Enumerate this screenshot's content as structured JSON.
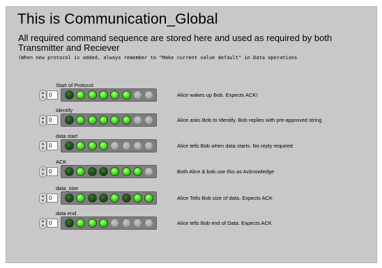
{
  "header": {
    "title": "This is Communication_Global",
    "description": "All required command sequence are stored here and used as required by both Transmitter and Reciever",
    "note": "(When new protocol is added, always remember to \"Make current value default\" in Data operations"
  },
  "colors": {
    "panel_bg": "#c8c8c8",
    "led_on": "#3fe814",
    "led_off": "#124a10",
    "led_na": "#a7a7a7"
  },
  "rows": [
    {
      "label": "Start of Protocol",
      "value": "0",
      "leds": [
        "off",
        "on",
        "on",
        "on",
        "on",
        "on",
        "na",
        "na"
      ],
      "description": "Alice wakes up Bob. Expects ACK!"
    },
    {
      "label": "Identify",
      "value": "0",
      "leds": [
        "off",
        "on",
        "on",
        "on",
        "on",
        "on",
        "na",
        "na"
      ],
      "description": "Alice asks Bob to Identify. Bob replies with pre-approved string"
    },
    {
      "label": "data start",
      "value": "0",
      "leds": [
        "off",
        "on",
        "on",
        "on",
        "na",
        "na",
        "na",
        "na"
      ],
      "description": "Alice tells Bob when data starts. No reply required"
    },
    {
      "label": "ACK",
      "value": "0",
      "leds": [
        "off",
        "on",
        "off",
        "off",
        "on",
        "on",
        "on",
        "na"
      ],
      "description": "Both Alice & bob use this as Acknowledge"
    },
    {
      "label": "data_size",
      "value": "0",
      "leds": [
        "off",
        "on",
        "off",
        "off",
        "on",
        "off",
        "on",
        "on"
      ],
      "description": "Alice Tells Bob size of data. Expects ACK"
    },
    {
      "label": "data end",
      "value": "0",
      "leds": [
        "off",
        "on",
        "on",
        "on",
        "na",
        "na",
        "na",
        "na"
      ],
      "description": "Alice tells Bob end of Data. Expects ACK"
    }
  ]
}
